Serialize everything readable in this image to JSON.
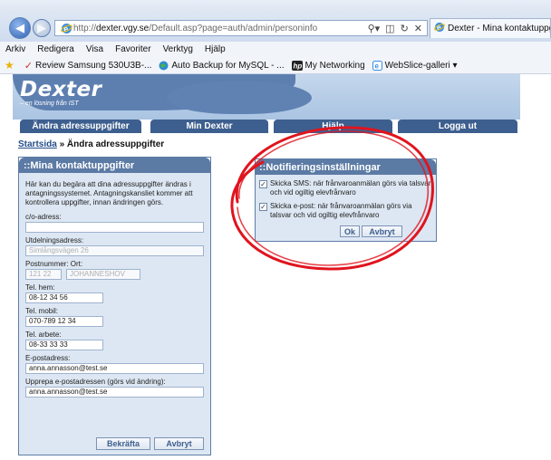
{
  "browser": {
    "url_prefix": "http://",
    "url_host": "dexter.vgy.se",
    "url_path": "/Default.asp?page=auth/admin/personinfo",
    "tab_title": "Dexter - Mina kontaktuppgi...",
    "menu": [
      "Arkiv",
      "Redigera",
      "Visa",
      "Favoriter",
      "Verktyg",
      "Hjälp"
    ],
    "favorites": [
      "Review Samsung 530U3B-...",
      "Auto Backup for MySQL - ...",
      "My Networking",
      "WebSlice-galleri ▾"
    ]
  },
  "site": {
    "logo": "Dexter",
    "tagline": "– en lösning från IST",
    "nav": [
      "Ändra adressuppgifter",
      "Min Dexter",
      "Hjälp",
      "Logga ut"
    ]
  },
  "breadcrumb": {
    "home": "Startsida",
    "separator": " » ",
    "current": "Ändra adressuppgifter"
  },
  "contact_panel": {
    "title": "::Mina kontaktuppgifter",
    "intro": "Här kan du begära att dina adressuppgifter ändras i antagningssystemet. Antagningskansliet kommer att kontrollera uppgifter, innan ändringen görs.",
    "co_label": "c/o-adress:",
    "co_value": "",
    "address_label": "Utdelningsadress:",
    "address_value": "Simlångsvägen 26",
    "postal_label": "Postnummer: Ort:",
    "postal_code": "121 22",
    "city": "JOHANNESHOV",
    "phone_home_label": "Tel. hem:",
    "phone_home": "08-12 34 56",
    "phone_mobile_label": "Tel. mobil:",
    "phone_mobile": "070-789 12 34",
    "phone_work_label": "Tel. arbete:",
    "phone_work": "08-33 33 33",
    "email_label": "E-postadress:",
    "email": "anna.annasson@test.se",
    "email_repeat_label": "Upprepa e-postadressen (görs vid ändring):",
    "email_repeat": "anna.annasson@test.se",
    "confirm_label": "Bekräfta",
    "cancel_label": "Avbryt"
  },
  "notif_panel": {
    "title": "::Notifieringsinställningar",
    "sms_label": "Skicka SMS: när frånvaroanmälan görs via talsvar och vid ogiltig elevfrånvaro",
    "sms_checked": true,
    "email_label": "Skicka e-post: när frånvaroanmälan görs via talsvar och vid ogiltig elevfrånvaro",
    "email_checked": true,
    "ok_label": "Ok",
    "cancel_label": "Avbryt"
  },
  "colors": {
    "panel_header": "#5b7aa4",
    "panel_body": "#dde7f3",
    "nav_tab": "#3d5f8f",
    "annotation": "#e0141e"
  }
}
